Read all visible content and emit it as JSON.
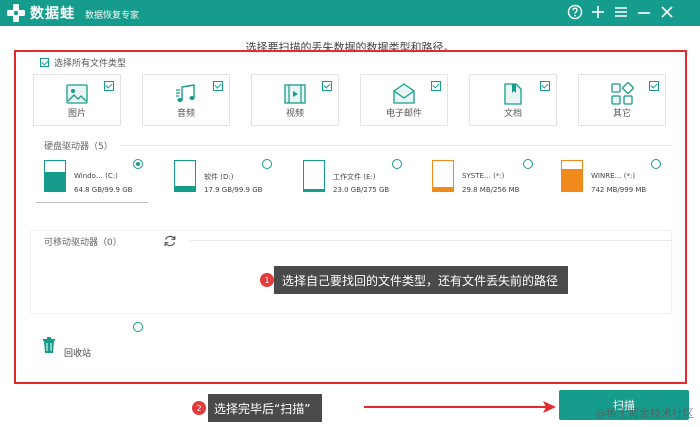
{
  "app": {
    "name": "数据蛙",
    "subtitle": "数据恢复专家"
  },
  "titlebar": {
    "buttons": [
      "help-icon",
      "plus-icon",
      "menu-icon",
      "minimize-icon",
      "close-icon"
    ]
  },
  "header": {
    "instruction": "选择要扫描的丢失数据的数据类型和路径。"
  },
  "select_all": {
    "label": "选择所有文件类型",
    "checked": true
  },
  "file_types": [
    {
      "label": "图片",
      "icon": "image-icon",
      "checked": true
    },
    {
      "label": "音频",
      "icon": "music-icon",
      "checked": true
    },
    {
      "label": "视频",
      "icon": "video-icon",
      "checked": true
    },
    {
      "label": "电子邮件",
      "icon": "email-icon",
      "checked": true
    },
    {
      "label": "文档",
      "icon": "document-icon",
      "checked": true
    },
    {
      "label": "其它",
      "icon": "other-icon",
      "checked": true
    }
  ],
  "drives_section": {
    "label": "硬盘驱动器（5）",
    "drives": [
      {
        "name": "Windo… (C:)",
        "size": "64.8 GB/99.9 GB",
        "selected": true,
        "used_fraction": 0.65,
        "color": "#169c8c"
      },
      {
        "name": "软件 (D:)",
        "size": "17.9 GB/99.9 GB",
        "selected": false,
        "used_fraction": 0.18,
        "color": "#169c8c"
      },
      {
        "name": "工作文件 (E:)",
        "size": "23.0 GB/275 GB",
        "selected": false,
        "used_fraction": 0.08,
        "color": "#169c8c"
      },
      {
        "name": "SYSTE… (*:)",
        "size": "29.8 MB/256 MB",
        "selected": false,
        "used_fraction": 0.12,
        "color": "#f08a1c"
      },
      {
        "name": "WINRE… (*:)",
        "size": "742 MB/999 MB",
        "selected": false,
        "used_fraction": 0.74,
        "color": "#f08a1c"
      }
    ]
  },
  "removable_section": {
    "label": "可移动驱动器（0）",
    "refresh_icon": "refresh-icon"
  },
  "recycle_bin": {
    "label": "回收站"
  },
  "tips": [
    {
      "num": "1",
      "text": "选择自己要找回的文件类型，还有文件丢失前的路径"
    },
    {
      "num": "2",
      "text": "选择完毕后“扫描”"
    }
  ],
  "scan_button": {
    "label": "扫描"
  },
  "watermark": "@稀土掘金技术社区",
  "colors": {
    "brand": "#169c8c",
    "annotation_red": "#e32b2b",
    "tooltip_bg": "#4a4a4a",
    "orange": "#f08a1c"
  }
}
